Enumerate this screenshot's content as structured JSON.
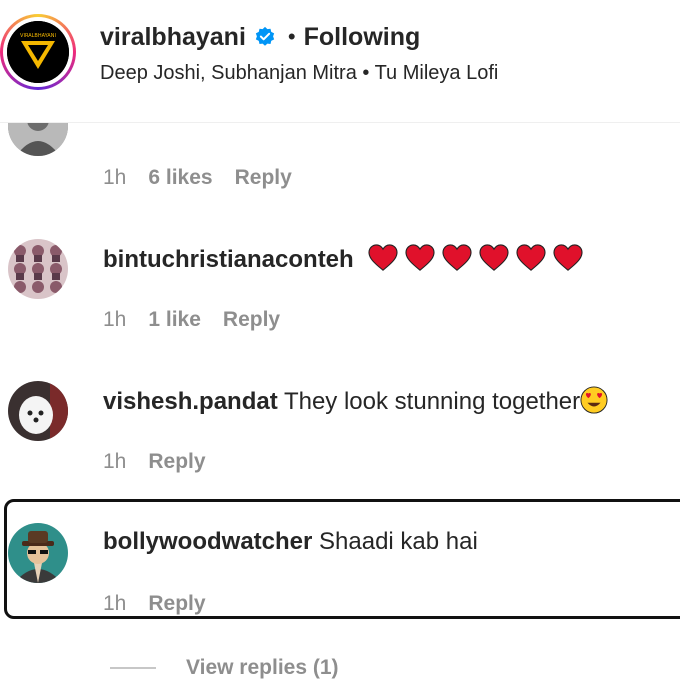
{
  "header": {
    "handle": "viralbhayani",
    "separator": "•",
    "follow_state": "Following",
    "audio_line": "Deep Joshi, Subhanjan Mitra • Tu Mileya Lofi",
    "logo_text": "VIRALBHAYANI"
  },
  "comments": [
    {
      "time": "1h",
      "likes": "6 likes",
      "reply": "Reply"
    },
    {
      "username": "bintuchristianaconteh",
      "time": "1h",
      "likes": "1 like",
      "reply": "Reply",
      "emoji": "red-heart x6"
    },
    {
      "username": "vishesh.pandat",
      "text": "They look stunning together",
      "time": "1h",
      "reply": "Reply",
      "emoji": "heart-eyes"
    },
    {
      "username": "bollywoodwatcher",
      "text": "Shaadi kab hai",
      "time": "1h",
      "reply": "Reply"
    }
  ],
  "view_replies": "View replies (1)",
  "colors": {
    "text": "#262626",
    "muted": "#8e8e8e",
    "verified": "#0095f6",
    "heart": "#e0112b",
    "logo_accent": "#f5b800"
  }
}
